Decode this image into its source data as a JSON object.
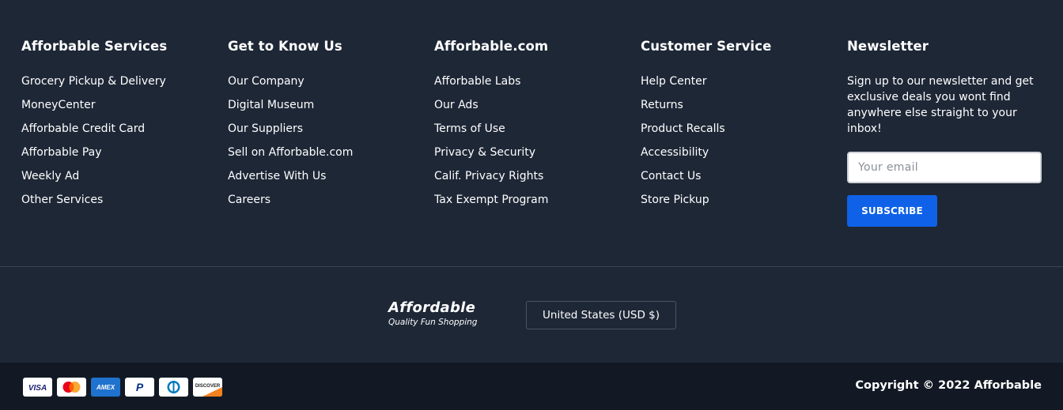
{
  "columns": [
    {
      "title": "Afforbable Services",
      "links": [
        "Grocery Pickup & Delivery",
        "MoneyCenter",
        "Afforbable Credit Card",
        "Afforbable Pay",
        "Weekly Ad",
        "Other Services"
      ]
    },
    {
      "title": "Get to Know Us",
      "links": [
        "Our Company",
        "Digital Museum",
        "Our Suppliers",
        "Sell on Afforbable.com",
        "Advertise With Us",
        "Careers"
      ]
    },
    {
      "title": "Afforbable.com",
      "links": [
        "Afforbable Labs",
        "Our Ads",
        "Terms of Use",
        "Privacy & Security",
        "Calif. Privacy Rights",
        "Tax Exempt Program"
      ]
    },
    {
      "title": "Customer Service",
      "links": [
        "Help Center",
        "Returns",
        "Product Recalls",
        "Accessibility",
        "Contact Us",
        "Store Pickup"
      ]
    }
  ],
  "newsletter": {
    "title": "Newsletter",
    "text": "Sign up to our newsletter and get exclusive deals you wont find anywhere else straight to your inbox!",
    "email_placeholder": "Your email",
    "subscribe_label": "SUBSCRIBE"
  },
  "brand": {
    "name": "Affordable",
    "tagline": "Quality Fun Shopping"
  },
  "currency_selector": {
    "label": "United States (USD $)"
  },
  "payments": {
    "icons": [
      "visa-icon",
      "mastercard-icon",
      "amex-icon",
      "paypal-icon",
      "diners-club-icon",
      "discover-icon"
    ],
    "visa_label": "VISA",
    "amex_label": "AMEX",
    "paypal_label": "P",
    "discover_label": "DISCOVER"
  },
  "copyright": "Copyright © 2022 Afforbable",
  "colors": {
    "background": "#1e2736",
    "bottom_bar": "#121924",
    "accent": "#0f62e8",
    "text": "#ffffff"
  }
}
